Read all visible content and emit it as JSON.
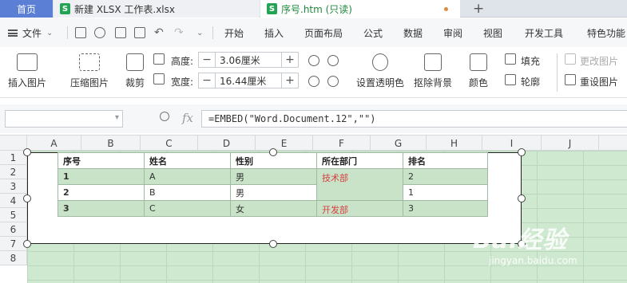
{
  "tabs": {
    "home": "首页",
    "xlsx": "新建 XLSX 工作表.xlsx",
    "htm": "序号.htm (只读)"
  },
  "menu": {
    "file": "文件",
    "items": [
      "开始",
      "插入",
      "页面布局",
      "公式",
      "数据",
      "审阅",
      "视图",
      "开发工具",
      "特色功能"
    ]
  },
  "ribbon": {
    "insert_pic": "插入图片",
    "compress_pic": "压缩图片",
    "crop": "裁剪",
    "height_label": "高度:",
    "height_value": "3.06厘米",
    "width_label": "宽度:",
    "width_value": "16.44厘米",
    "set_transparent": "设置透明色",
    "remove_bg": "抠除背景",
    "color": "颜色",
    "fill": "填充",
    "outline": "轮廓",
    "change_pic": "更改图片",
    "reset_size": "重设图片"
  },
  "formula_bar": {
    "name_box": "",
    "fx": "fx",
    "formula": "=EMBED(\"Word.Document.12\",\"\")"
  },
  "columns": [
    "A",
    "B",
    "C",
    "D",
    "E",
    "F",
    "G",
    "H",
    "I",
    "J"
  ],
  "rows": [
    "1",
    "2",
    "3",
    "4",
    "5",
    "6",
    "7",
    "8"
  ],
  "table": {
    "headers": [
      "序号",
      "姓名",
      "性别",
      "所在部门",
      "排名"
    ],
    "rows": [
      [
        "1",
        "A",
        "男",
        "技术部",
        "2"
      ],
      [
        "2",
        "B",
        "男",
        "",
        "1"
      ],
      [
        "3",
        "C",
        "女",
        "开发部",
        "3"
      ]
    ]
  },
  "watermark": {
    "logo": "Bai经验",
    "url": "jingyan.baidu.com"
  }
}
